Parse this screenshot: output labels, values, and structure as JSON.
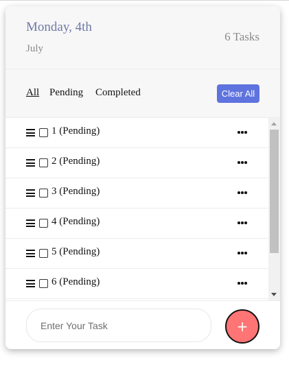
{
  "header": {
    "date_main": "Monday, 4th",
    "date_sub": "July",
    "task_count": "6 Tasks"
  },
  "filters": {
    "all": "All",
    "pending": "Pending",
    "completed": "Completed",
    "active": "all",
    "clear_all": "Clear All"
  },
  "tasks": [
    {
      "text": "1 (Pending)",
      "checked": false
    },
    {
      "text": "2 (Pending)",
      "checked": false
    },
    {
      "text": "3 (Pending)",
      "checked": false
    },
    {
      "text": "4 (Pending)",
      "checked": false
    },
    {
      "text": "5 (Pending)",
      "checked": false
    },
    {
      "text": "6 (Pending)",
      "checked": false
    }
  ],
  "input": {
    "value": "",
    "placeholder": "Enter Your Task"
  },
  "add_button": {
    "label": "+"
  },
  "icons": {
    "drag": "hamburger-drag-icon",
    "menu": "more-horizontal-icon",
    "add": "plus-icon"
  },
  "colors": {
    "accent": "#5f73de",
    "add_button": "#ff7474",
    "date": "#6f7aa6"
  }
}
